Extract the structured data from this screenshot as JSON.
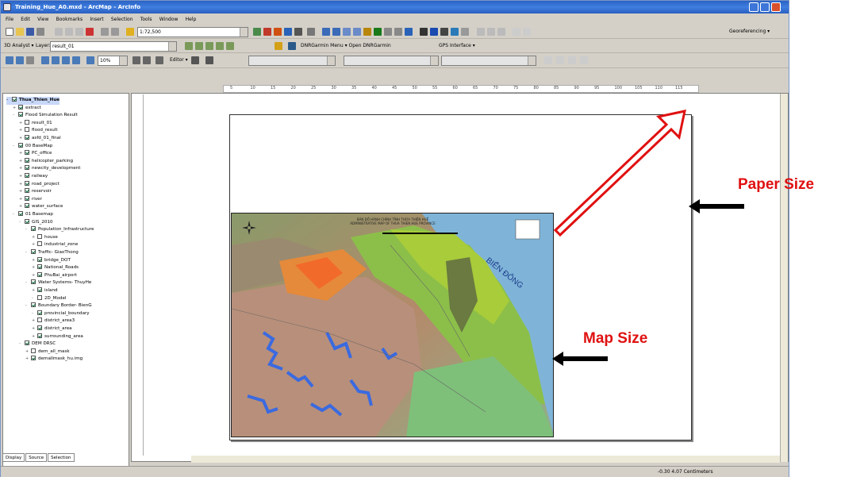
{
  "window": {
    "title": "Training_Hue_A0.mxd - ArcMap - ArcInfo"
  },
  "menu": [
    "File",
    "Edit",
    "View",
    "Bookmarks",
    "Insert",
    "Selection",
    "Tools",
    "Window",
    "Help"
  ],
  "toolbar1": {
    "scale": "1:72,500",
    "georef": "Georeferencing ▾"
  },
  "toolbar2": {
    "analyst": "3D Analyst ▾",
    "layer_label": "Layer:",
    "layer_value": "result_01",
    "dnr_menu": "DNRGarmin Menu ▾  Open DNRGarmin",
    "gps": "GPS Interface ▾"
  },
  "toolbar3": {
    "zoom": "10%",
    "editor": "Editor ▾"
  },
  "ruler": [
    "5",
    "10",
    "15",
    "20",
    "25",
    "30",
    "35",
    "40",
    "45",
    "50",
    "55",
    "60",
    "65",
    "70",
    "75",
    "80",
    "85",
    "90",
    "95",
    "100",
    "105",
    "110",
    "115"
  ],
  "toc": {
    "items": [
      {
        "label": "Thua_Thien_Hue",
        "level": 0,
        "checked": true,
        "expand": "-"
      },
      {
        "label": "extract",
        "level": 1,
        "checked": true,
        "expand": "+"
      },
      {
        "label": "Flood Simulation Result",
        "level": 1,
        "checked": true,
        "expand": "-"
      },
      {
        "label": "result_01",
        "level": 2,
        "checked": false,
        "expand": "+"
      },
      {
        "label": "flood_result",
        "level": 2,
        "checked": false,
        "expand": "+"
      },
      {
        "label": "asfd_01_final",
        "level": 2,
        "checked": true,
        "expand": "+"
      },
      {
        "label": "00 BaseMap",
        "level": 1,
        "checked": true,
        "expand": "-"
      },
      {
        "label": "PC_office",
        "level": 2,
        "checked": true,
        "expand": "+"
      },
      {
        "label": "helicopter_parking",
        "level": 2,
        "checked": true,
        "expand": "+"
      },
      {
        "label": "newcity_development",
        "level": 2,
        "checked": true,
        "expand": "+"
      },
      {
        "label": "railway",
        "level": 2,
        "checked": true,
        "expand": "+"
      },
      {
        "label": "road_project",
        "level": 2,
        "checked": true,
        "expand": "+"
      },
      {
        "label": "reservoir",
        "level": 2,
        "checked": true,
        "expand": "+"
      },
      {
        "label": "river",
        "level": 2,
        "checked": true,
        "expand": "+"
      },
      {
        "label": "water_surface",
        "level": 2,
        "checked": true,
        "expand": "+"
      },
      {
        "label": "01 Basemap",
        "level": 1,
        "checked": true,
        "expand": "-"
      },
      {
        "label": "GIS_2010",
        "level": 2,
        "checked": true,
        "expand": "-"
      },
      {
        "label": "Population_Infrastructure",
        "level": 3,
        "checked": true,
        "expand": "-"
      },
      {
        "label": "house",
        "level": 4,
        "checked": false,
        "expand": "+"
      },
      {
        "label": "industrial_zone",
        "level": 4,
        "checked": false,
        "expand": "+"
      },
      {
        "label": "Traffic- GiaoThong",
        "level": 3,
        "checked": true,
        "expand": "-"
      },
      {
        "label": "bridge_DOT",
        "level": 4,
        "checked": true,
        "expand": "+"
      },
      {
        "label": "National_Roads",
        "level": 4,
        "checked": true,
        "expand": "+"
      },
      {
        "label": "PhuBai_airport",
        "level": 4,
        "checked": true,
        "expand": "+"
      },
      {
        "label": "Water Systems- ThuyHe",
        "level": 3,
        "checked": true,
        "expand": "-"
      },
      {
        "label": "island",
        "level": 4,
        "checked": true,
        "expand": "+"
      },
      {
        "label": "2D_Model",
        "level": 4,
        "checked": false,
        "expand": "-"
      },
      {
        "label": "Boundary Border- BienG",
        "level": 3,
        "checked": true,
        "expand": "-"
      },
      {
        "label": "provincial_boundary",
        "level": 4,
        "checked": true,
        "expand": "-"
      },
      {
        "label": "district_area3",
        "level": 4,
        "checked": false,
        "expand": "+"
      },
      {
        "label": "district_area",
        "level": 4,
        "checked": true,
        "expand": "+"
      },
      {
        "label": "surrounding_area",
        "level": 4,
        "checked": true,
        "expand": "+"
      },
      {
        "label": "DEM DRSC",
        "level": 2,
        "checked": true,
        "expand": "-"
      },
      {
        "label": "dem_all_mask",
        "level": 3,
        "checked": false,
        "expand": "+"
      },
      {
        "label": "demallmask_hu.img",
        "level": 3,
        "checked": true,
        "expand": "+"
      }
    ]
  },
  "toc_tabs": [
    "Display",
    "Source",
    "Selection"
  ],
  "map": {
    "title_line1": "BẢN ĐỒ HÀNH CHÍNH TỈNH THỪA THIÊN HUẾ",
    "title_line2": "ADMINISTRATIVE MAP OF THUA THIEN HUE PROVINCE",
    "sea_label": "BIỂN ĐÔNG"
  },
  "annotations": {
    "paper": "Paper Size",
    "map": "Map Size"
  },
  "status": {
    "coords": "-0.30  4.07 Centimeters"
  },
  "colors": {
    "annotation": "#e01010",
    "title_bar": "#2b63c4"
  }
}
